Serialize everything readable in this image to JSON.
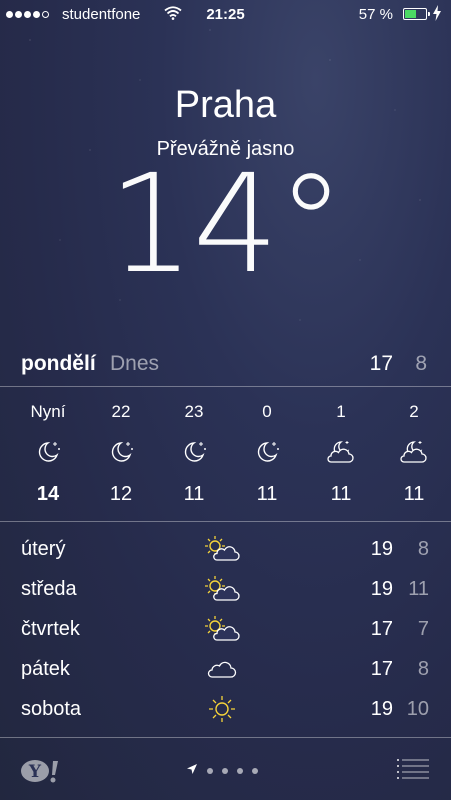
{
  "status_bar": {
    "signal_strength": 4,
    "carrier": "studentfone",
    "time": "21:25",
    "battery_percent": "57 %",
    "battery_level": 0.57,
    "battery_color": "#4cd964",
    "charging_icon": "bolt-icon",
    "wifi_icon": "wifi-icon"
  },
  "location": {
    "city": "Praha",
    "condition": "Převážně jasno",
    "temperature": "14°"
  },
  "today": {
    "day": "pondělí",
    "label": "Dnes",
    "high": "17",
    "low": "8"
  },
  "hourly": [
    {
      "time": "Nyní",
      "icon": "moon-stars-icon",
      "temp": "14"
    },
    {
      "time": "22",
      "icon": "moon-stars-icon",
      "temp": "12"
    },
    {
      "time": "23",
      "icon": "moon-stars-icon",
      "temp": "11"
    },
    {
      "time": "0",
      "icon": "moon-stars-icon",
      "temp": "11"
    },
    {
      "time": "1",
      "icon": "moon-cloud-icon",
      "temp": "11"
    },
    {
      "time": "2",
      "icon": "moon-cloud-icon",
      "temp": "11"
    }
  ],
  "daily": [
    {
      "day": "úterý",
      "icon": "partly-sunny-icon",
      "high": "19",
      "low": "8"
    },
    {
      "day": "středa",
      "icon": "partly-sunny-icon",
      "high": "19",
      "low": "11"
    },
    {
      "day": "čtvrtek",
      "icon": "partly-sunny-icon",
      "high": "17",
      "low": "7"
    },
    {
      "day": "pátek",
      "icon": "cloud-icon",
      "high": "17",
      "low": "8"
    },
    {
      "day": "sobota",
      "icon": "sun-icon",
      "high": "19",
      "low": "10"
    }
  ],
  "bottom_bar": {
    "logo_icon": "yahoo-logo",
    "location_icon": "location-arrow-icon",
    "page_count": 5,
    "current_page": 1,
    "menu_icon": "list-icon"
  },
  "colors": {
    "background": "#262b4b",
    "sun": "#f5d33a",
    "secondary_text": "rgba(255,255,255,0.55)"
  }
}
